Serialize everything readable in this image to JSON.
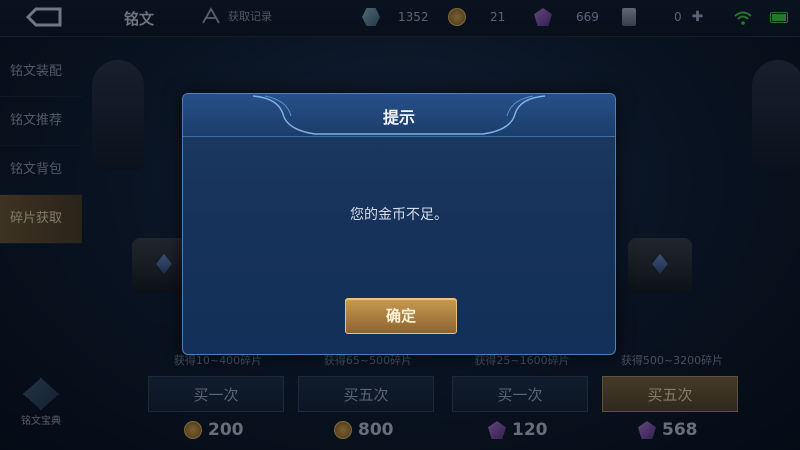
{
  "header": {
    "title": "铭文",
    "record_label": "获取记录",
    "resources": [
      {
        "icon": "crystal-icon",
        "value": "1352"
      },
      {
        "icon": "gold-coin-icon",
        "value": "21"
      },
      {
        "icon": "gem-icon",
        "value": "669"
      },
      {
        "icon": "ticket-icon",
        "value": "0"
      }
    ]
  },
  "sidebar": {
    "items": [
      {
        "label": "铭文装配",
        "active": false
      },
      {
        "label": "铭文推荐",
        "active": false
      },
      {
        "label": "铭文背包",
        "active": false
      },
      {
        "label": "碎片获取",
        "active": true
      }
    ],
    "codex_label": "铭文宝典"
  },
  "offers": [
    {
      "gain": "获得10~400碎片",
      "button": "买一次",
      "currency": "gold-coin-icon",
      "price": "200"
    },
    {
      "gain": "获得65~500碎片",
      "button": "买五次",
      "currency": "gold-coin-icon",
      "price": "800"
    },
    {
      "gain": "获得25~1600碎片",
      "button": "买一次",
      "currency": "gem-icon",
      "price": "120"
    },
    {
      "gain": "获得500~3200碎片",
      "button": "买五次",
      "currency": "gem-icon",
      "price": "568"
    }
  ],
  "dialog": {
    "title": "提示",
    "message": "您的金币不足。",
    "confirm_label": "确定"
  },
  "colors": {
    "accent_gold": "#c79a52",
    "dialog_blue": "#1c3a63",
    "status_green": "#3ecf4a"
  }
}
